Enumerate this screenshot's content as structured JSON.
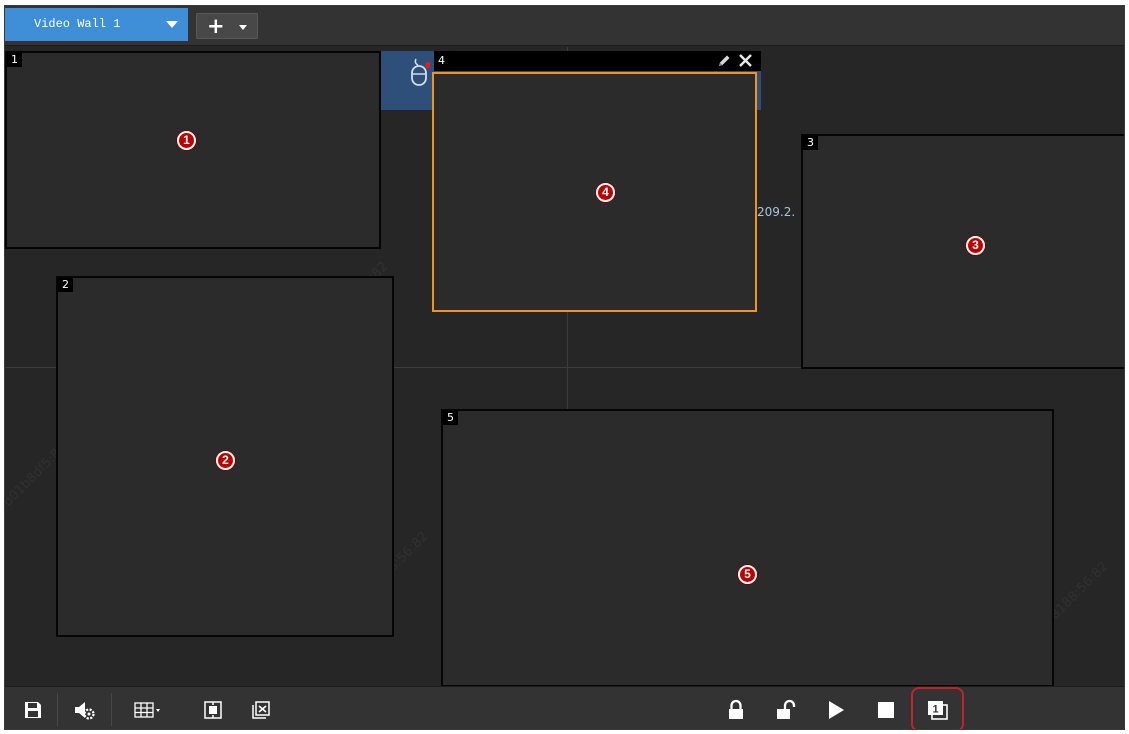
{
  "tabs": [
    {
      "label": "Video Wall 1",
      "active": true
    }
  ],
  "add_tab": {
    "icon": "plus-icon",
    "dropdown_icon": "caret-down-icon"
  },
  "windows": [
    {
      "number": "1",
      "marker": "1"
    },
    {
      "number": "2",
      "marker": "2"
    },
    {
      "number": "3",
      "marker": "3"
    },
    {
      "number": "4",
      "marker": "4",
      "selected": true
    },
    {
      "number": "5",
      "marker": "5"
    }
  ],
  "decoder": {
    "ip_fragment": "209.2.",
    "icon": "mouse-icon"
  },
  "watermark": "b01b8df5:8188:56:82",
  "toolbar": {
    "left": [
      "save-icon",
      "audio-settings-icon",
      "window-division-icon",
      "fullscreen-window-icon",
      "clear-window-icon"
    ],
    "right": [
      "lock-icon",
      "unlock-icon",
      "play-icon",
      "stop-icon",
      "wall-number-icon"
    ],
    "wall_number": "1"
  },
  "colors": {
    "accent": "#3e8ed8",
    "selected_border": "#f0941e",
    "marker": "#c00000",
    "highlight": "#c0232b",
    "decoder_tile": "#2e4f7a"
  }
}
